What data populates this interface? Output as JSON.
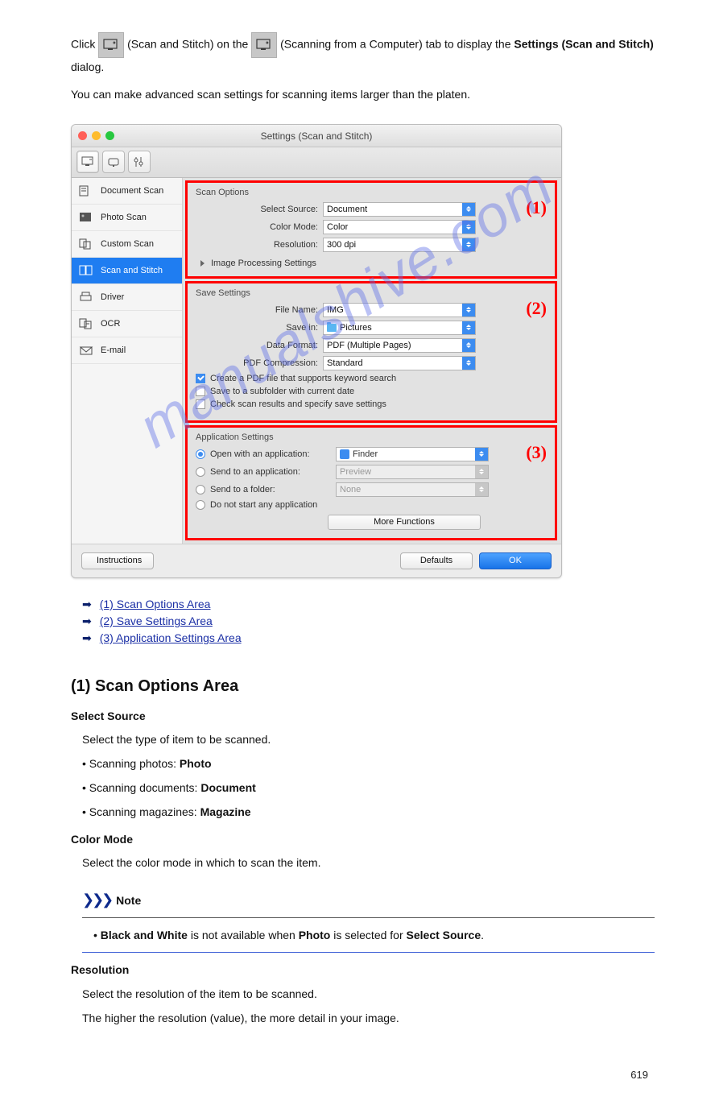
{
  "intro_line1_a": "Click ",
  "intro_line1_b": " (Scan and Stitch) on the ",
  "intro_line1_c": " (Scanning from a Computer) tab to display the ",
  "intro_line1_d": "Settings (Scan and Stitch)",
  "intro_line1_e": " dialog.",
  "intro_line2": "You can make advanced scan settings for scanning items larger than the platen.",
  "dialog": {
    "title": "Settings (Scan and Stitch)",
    "sidebar": [
      "Document Scan",
      "Photo Scan",
      "Custom Scan",
      "Scan and Stitch",
      "Driver",
      "OCR",
      "E-mail"
    ],
    "scan_options": {
      "title": "Scan Options",
      "select_source_label": "Select Source:",
      "select_source_value": "Document",
      "color_mode_label": "Color Mode:",
      "color_mode_value": "Color",
      "resolution_label": "Resolution:",
      "resolution_value": "300 dpi",
      "image_processing": "Image Processing Settings",
      "marker": "(1)"
    },
    "save_settings": {
      "title": "Save Settings",
      "file_name_label": "File Name:",
      "file_name_value": "IMG",
      "save_in_label": "Save in:",
      "save_in_value": "Pictures",
      "data_format_label": "Data Format:",
      "data_format_value": "PDF (Multiple Pages)",
      "pdf_comp_label": "PDF Compression:",
      "pdf_comp_value": "Standard",
      "chk1": "Create a PDF file that supports keyword search",
      "chk2": "Save to a subfolder with current date",
      "chk3": "Check scan results and specify save settings",
      "marker": "(2)"
    },
    "app_settings": {
      "title": "Application Settings",
      "r1": "Open with an application:",
      "r1_val": "Finder",
      "r2": "Send to an application:",
      "r2_val": "Preview",
      "r3": "Send to a folder:",
      "r3_val": "None",
      "r4": "Do not start any application",
      "more": "More Functions",
      "marker": "(3)"
    },
    "footer": {
      "instructions": "Instructions",
      "defaults": "Defaults",
      "ok": "OK"
    }
  },
  "links": {
    "l1": "(1) Scan Options Area",
    "l2": "(2) Save Settings Area",
    "l3": "(3) Application Settings Area"
  },
  "section_h": "(1) Scan Options Area",
  "term1": "Select Source",
  "term1_desc": "Select the type of item to be scanned.",
  "bullets": {
    "b1_l": "Scanning photos:",
    "b1_r": "Photo",
    "b2_l": "Scanning documents:",
    "b2_r": "Document",
    "b3_l": "Scanning magazines:",
    "b3_r": "Magazine"
  },
  "term2": "Color Mode",
  "term2_desc": "Select the color mode in which to scan the item.",
  "term3": "Resolution",
  "term3_desc": "Select the resolution of the item to be scanned.",
  "term3_desc2": "The higher the resolution (value), the more detail in your image.",
  "note": {
    "label": "Note",
    "body_a": "Black and White",
    " body_b": " is not available when ",
    "body_c": "Photo",
    "body_d": " is selected for ",
    "body_e": "Select Source",
    "body_f": "."
  },
  "note_bullet": "• ",
  "page_num": "619",
  "watermark": "manualshive.com"
}
